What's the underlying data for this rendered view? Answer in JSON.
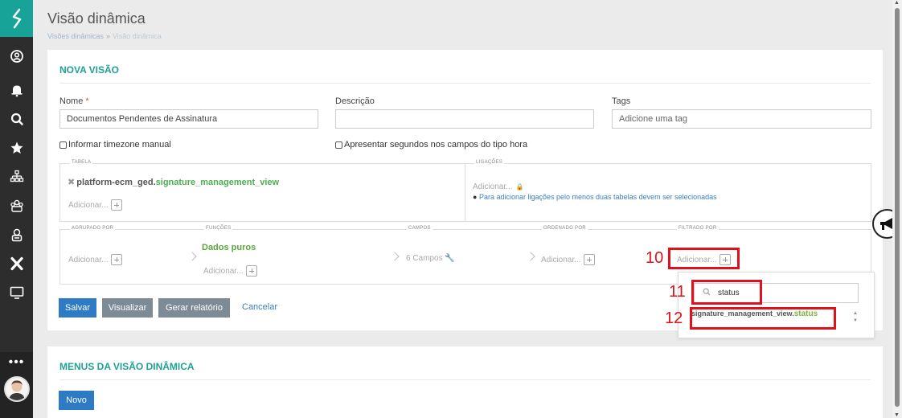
{
  "header": {
    "title": "Visão dinâmica",
    "breadcrumb_root": "Visões dinâmicas",
    "breadcrumb_sep": "»",
    "breadcrumb_current": "Visão dinâmica"
  },
  "form": {
    "section_title": "NOVA VISÃO",
    "name_label": "Nome",
    "name_required": "*",
    "name_value": "Documentos Pendentes de Assinatura",
    "desc_label": "Descrição",
    "desc_value": "",
    "tags_label": "Tags",
    "tags_placeholder": "Adicione uma tag",
    "chk_timezone": "Informar timezone manual",
    "chk_seconds": "Apresentar segundos nos campos do tipo hora"
  },
  "tabela": {
    "legend": "TABELA",
    "remove": "✖",
    "table_prefix": "platform-ecm_ged.",
    "table_view": "signature_management_view",
    "add": "Adicionar..."
  },
  "ligacoes": {
    "legend": "LIGAÇÕES",
    "add": "Adicionar...",
    "info": "Para adicionar ligações pelo menos duas tabelas devem ser selecionadas"
  },
  "agrupado": {
    "legend": "AGRUPADO POR",
    "add": "Adicionar..."
  },
  "funcoes": {
    "legend": "FUNÇÕES",
    "value": "Dados puros",
    "add": "Adicionar..."
  },
  "campos": {
    "legend": "CAMPOS",
    "value": "6 Campos"
  },
  "ordenado": {
    "legend": "ORDENADO POR",
    "add": "Adicionar..."
  },
  "filtrado": {
    "legend": "FILTRADO POR",
    "add": "Adicionar..."
  },
  "buttons": {
    "save": "Salvar",
    "preview": "Visualizar",
    "report": "Gerar relatório",
    "cancel": "Cancelar"
  },
  "dropdown": {
    "search_value": "status",
    "result_prefix": "signature_management_view.",
    "result_field": "status"
  },
  "annotations": {
    "a10": "10",
    "a11": "11",
    "a12": "12"
  },
  "menus": {
    "title": "MENUS DA VISÃO DINÂMICA",
    "new": "Novo"
  },
  "sidebar": {
    "more": "•••"
  },
  "colors": {
    "accent": "#17a398",
    "primary": "#2c7bc4",
    "annotation": "#e0101c"
  }
}
